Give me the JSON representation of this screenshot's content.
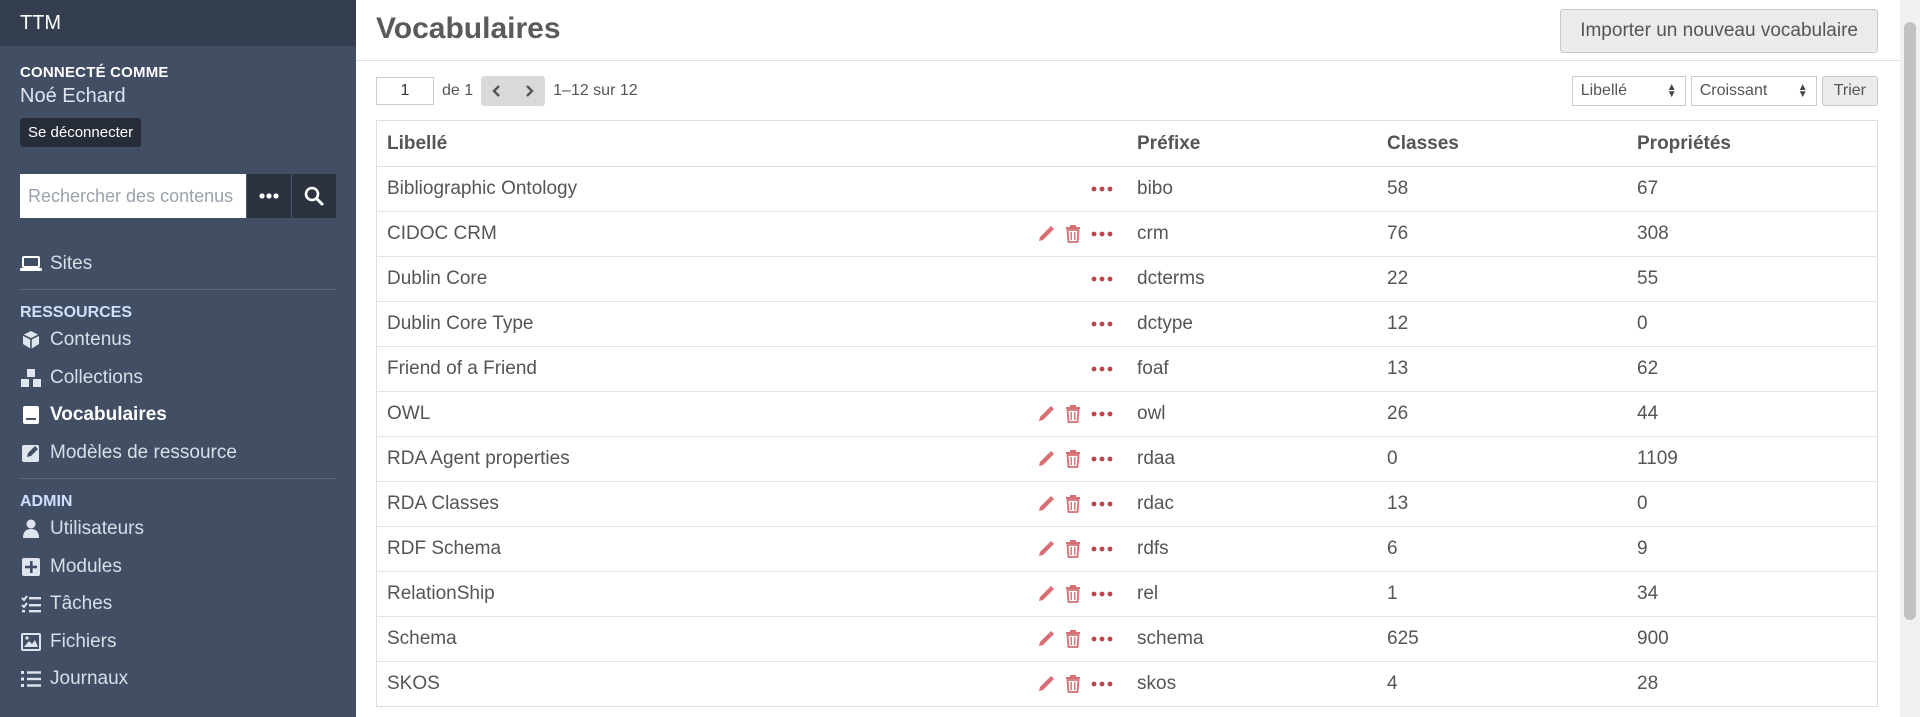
{
  "brand": "TTM",
  "user": {
    "caption": "Connecté comme",
    "name": "Noé Echard",
    "logout": "Se déconnecter"
  },
  "search": {
    "placeholder": "Rechercher des contenus"
  },
  "nav": {
    "sites": "Sites",
    "resources_head": "Ressources",
    "contenus": "Contenus",
    "collections": "Collections",
    "vocabulaires": "Vocabulaires",
    "modeles": "Modèles de ressource",
    "admin_head": "Admin",
    "utilisateurs": "Utilisateurs",
    "modules": "Modules",
    "taches": "Tâches",
    "fichiers": "Fichiers",
    "journaux": "Journaux"
  },
  "page": {
    "title": "Vocabulaires",
    "import_label": "Importer un nouveau vocabulaire"
  },
  "pagination": {
    "page": "1",
    "of_label": "de 1",
    "range": "1–12 sur 12"
  },
  "sort": {
    "field": "Libellé",
    "order": "Croissant",
    "button": "Trier"
  },
  "table": {
    "headers": {
      "label": "Libellé",
      "prefix": "Préfixe",
      "classes": "Classes",
      "properties": "Propriétés"
    },
    "rows": [
      {
        "label": "Bibliographic Ontology",
        "prefix": "bibo",
        "classes": "58",
        "properties": "67",
        "editable": false
      },
      {
        "label": "CIDOC CRM",
        "prefix": "crm",
        "classes": "76",
        "properties": "308",
        "editable": true
      },
      {
        "label": "Dublin Core",
        "prefix": "dcterms",
        "classes": "22",
        "properties": "55",
        "editable": false
      },
      {
        "label": "Dublin Core Type",
        "prefix": "dctype",
        "classes": "12",
        "properties": "0",
        "editable": false
      },
      {
        "label": "Friend of a Friend",
        "prefix": "foaf",
        "classes": "13",
        "properties": "62",
        "editable": false
      },
      {
        "label": "OWL",
        "prefix": "owl",
        "classes": "26",
        "properties": "44",
        "editable": true
      },
      {
        "label": "RDA Agent properties",
        "prefix": "rdaa",
        "classes": "0",
        "properties": "1109",
        "editable": true
      },
      {
        "label": "RDA Classes",
        "prefix": "rdac",
        "classes": "13",
        "properties": "0",
        "editable": true
      },
      {
        "label": "RDF Schema",
        "prefix": "rdfs",
        "classes": "6",
        "properties": "9",
        "editable": true
      },
      {
        "label": "RelationShip",
        "prefix": "rel",
        "classes": "1",
        "properties": "34",
        "editable": true
      },
      {
        "label": "Schema",
        "prefix": "schema",
        "classes": "625",
        "properties": "900",
        "editable": true
      },
      {
        "label": "SKOS",
        "prefix": "skos",
        "classes": "4",
        "properties": "28",
        "editable": true
      }
    ]
  },
  "colors": {
    "sidebar": "#424e63",
    "sidebar_top": "#343e4f",
    "accent": "#a4323a"
  }
}
